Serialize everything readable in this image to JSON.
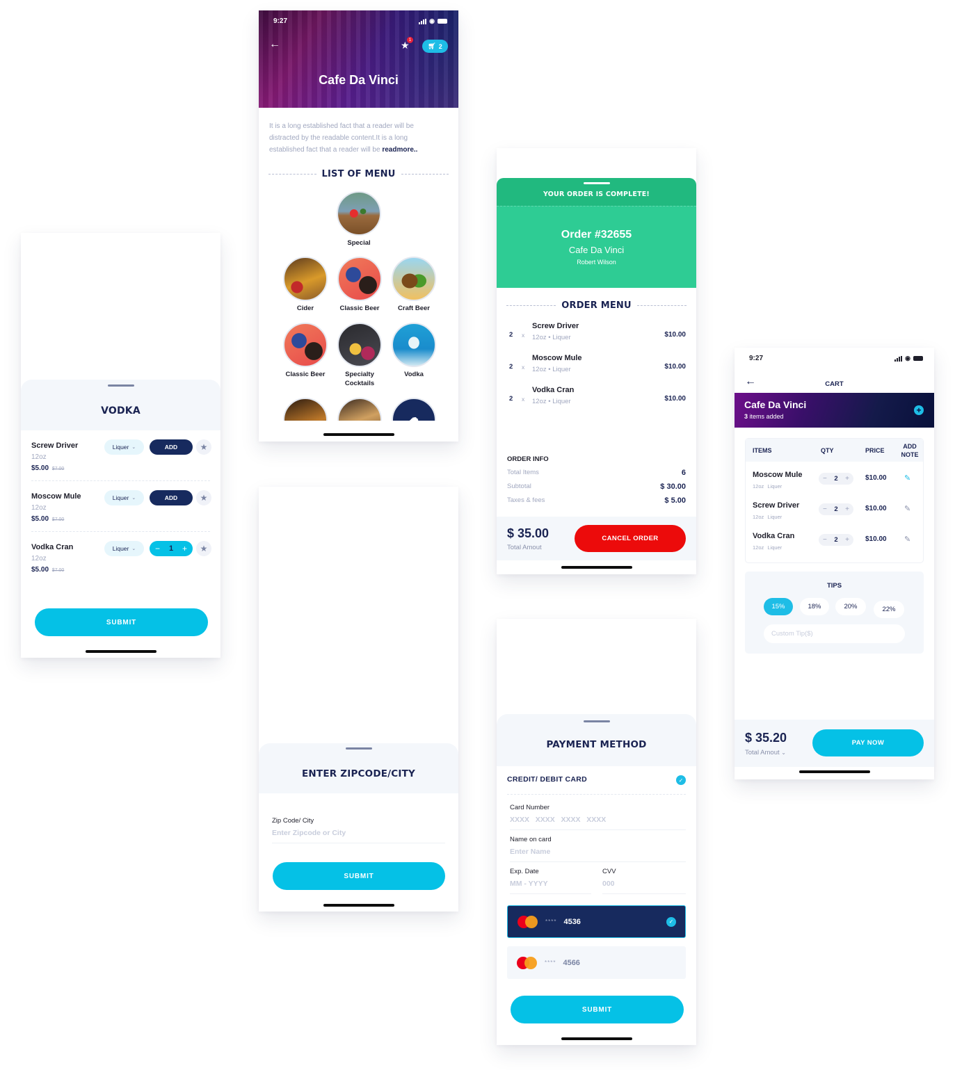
{
  "vodka_screen": {
    "title": "VODKA",
    "items": [
      {
        "name": "Screw Driver",
        "size": "12oz",
        "price": "$5.00",
        "old_price": "$7.00",
        "category": "Liquer",
        "action": "ADD"
      },
      {
        "name": "Moscow Mule",
        "size": "12oz",
        "price": "$5.00",
        "old_price": "$7.00",
        "category": "Liquer",
        "action": "ADD"
      },
      {
        "name": "Vodka Cran",
        "size": "12oz",
        "price": "$5.00",
        "old_price": "$7.00",
        "category": "Liquer",
        "quantity": "1"
      }
    ],
    "submit_label": "SUBMIT"
  },
  "menu_screen": {
    "status_time": "9:27",
    "favorites_badge": "1",
    "cart_count": "2",
    "restaurant": "Cafe Da Vinci",
    "description": "It is a long established fact that a reader will be distracted by the readable content.It is a long established fact that a reader will be ",
    "readmore_label": "readmore..",
    "section_title": "LIST OF MENU",
    "special_label": "Special",
    "categories": [
      {
        "label": "Cider"
      },
      {
        "label": "Classic Beer"
      },
      {
        "label": "Craft Beer"
      },
      {
        "label": "Classic Beer"
      },
      {
        "label": "Specialty Cocktails"
      },
      {
        "label": "Vodka"
      }
    ]
  },
  "zip_screen": {
    "title": "ENTER ZIPCODE/CITY",
    "field_label": "Zip Code/ City",
    "placeholder": "Enter Zipcode or City",
    "submit_label": "SUBMIT"
  },
  "order_screen": {
    "banner": "YOUR ORDER IS COMPLETE!",
    "order_number": "Order #32655",
    "restaurant": "Cafe Da Vinci",
    "customer": "Robert Wilson",
    "section_title": "ORDER MENU",
    "items": [
      {
        "qty": "2",
        "x": "x",
        "name": "Screw Driver",
        "size": "12oz",
        "category": "Liquer",
        "price": "$10.00"
      },
      {
        "qty": "2",
        "x": "x",
        "name": "Moscow Mule",
        "size": "12oz",
        "category": "Liquer",
        "price": "$10.00"
      },
      {
        "qty": "2",
        "x": "x",
        "name": "Vodka Cran",
        "size": "12oz",
        "category": "Liquer",
        "price": "$10.00"
      }
    ],
    "info_title": "ORDER INFO",
    "info": [
      {
        "label": "Total Items",
        "value": "6"
      },
      {
        "label": "Subtotal",
        "value": "$ 30.00"
      },
      {
        "label": "Taxes & fees",
        "value": "$ 5.00"
      }
    ],
    "total": "$ 35.00",
    "total_label": "Total Amout",
    "cancel_label": "CANCEL ORDER"
  },
  "payment_screen": {
    "title": "PAYMENT METHOD",
    "method": "CREDIT/ DEBIT CARD",
    "card_number_label": "Card Number",
    "card_number_placeholder": "XXXX   XXXX   XXXX   XXXX",
    "name_label": "Name on card",
    "name_placeholder": "Enter Name",
    "exp_label": "Exp. Date",
    "exp_placeholder": "MM - YYYY",
    "cvv_label": "CVV",
    "cvv_placeholder": "000",
    "saved_cards": [
      {
        "mask": "****",
        "last4": "4536",
        "selected": true
      },
      {
        "mask": "****",
        "last4": "4566",
        "selected": false
      }
    ],
    "submit_label": "SUBMIT"
  },
  "cart_screen": {
    "status_time": "9:27",
    "title": "CART",
    "restaurant": "Cafe Da Vinci",
    "items_count": "3",
    "items_added_label": " items added",
    "columns": {
      "items": "ITEMS",
      "qty": "QTY",
      "price": "PRICE",
      "note": "ADD NOTE"
    },
    "items": [
      {
        "name": "Moscow Mule",
        "size": "12oz",
        "category": "Liquer",
        "qty": "2",
        "price": "$10.00"
      },
      {
        "name": "Screw Driver",
        "size": "12oz",
        "category": "Liquer",
        "qty": "2",
        "price": "$10.00"
      },
      {
        "name": "Vodka Cran",
        "size": "12oz",
        "category": "Liquer",
        "qty": "2",
        "price": "$10.00"
      }
    ],
    "tips_title": "TIPS",
    "tips": [
      "15%",
      "18%",
      "20%",
      "22%"
    ],
    "selected_tip": "15%",
    "custom_tip_placeholder": "Custom Tip($)",
    "total": "$ 35.20",
    "total_label": "Total Amout",
    "pay_label": "PAY NOW"
  },
  "colors": {
    "navy": "#1a2352",
    "cyan": "#05c1e6",
    "green": "#2ecc94",
    "red": "#ec0b0b"
  }
}
